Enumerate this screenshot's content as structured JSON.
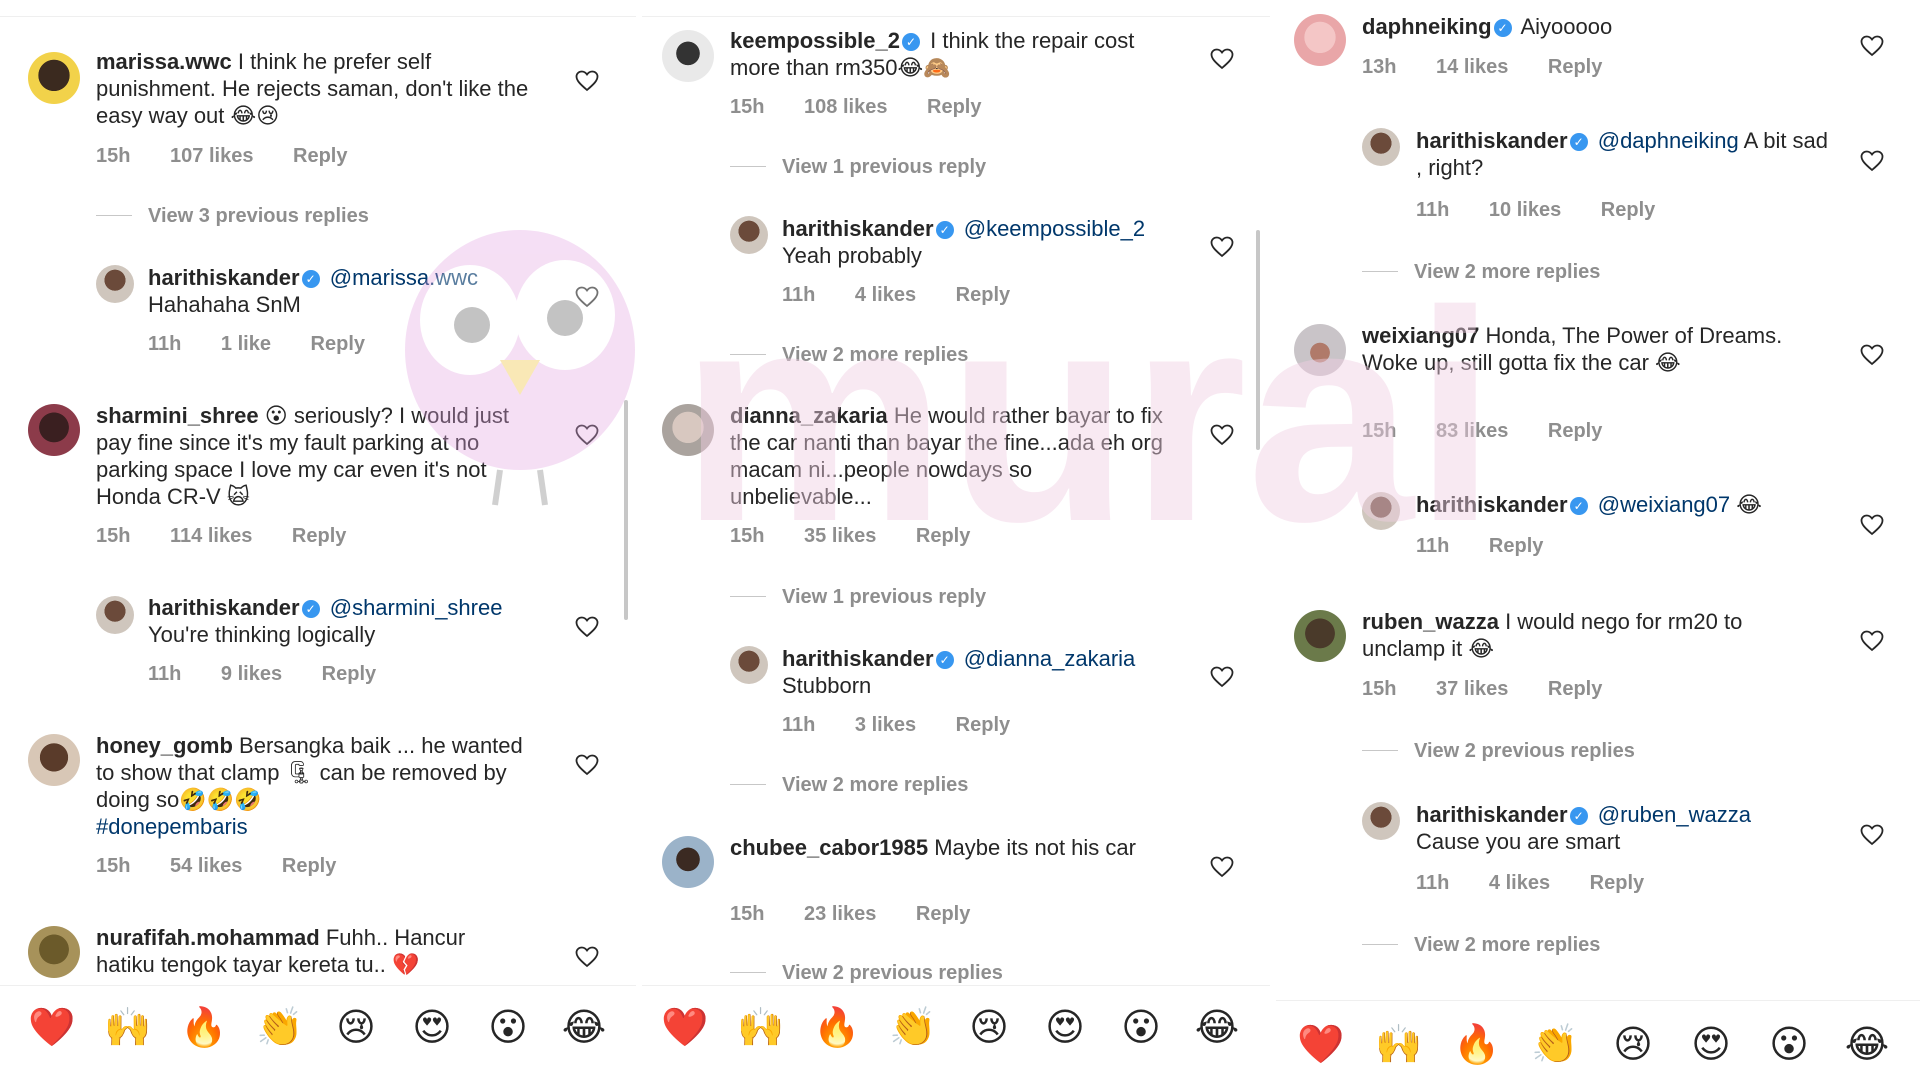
{
  "panels": [
    {
      "comments": [
        {
          "user": "marissa.wwc",
          "text": "I think he prefer self punishment. He rejects saman, don't like the easy way out 😂😢",
          "time": "15h",
          "likes": "107 likes",
          "reply": "Reply"
        },
        {
          "view": "View 3 previous replies"
        },
        {
          "user": "harithiskander",
          "mention": "@marissa.wwc",
          "text": "Hahahaha SnM",
          "time": "11h",
          "likes": "1 like",
          "reply": "Reply"
        },
        {
          "user": "sharmini_shree",
          "text": "😮 seriously? I would just pay fine since it's my fault parking at no parking space  I love my car even it's not Honda CR-V 🙀",
          "time": "15h",
          "likes": "114 likes",
          "reply": "Reply"
        },
        {
          "user": "harithiskander",
          "mention": "@sharmini_shree",
          "text": "You're thinking logically",
          "time": "11h",
          "likes": "9 likes",
          "reply": "Reply"
        },
        {
          "user": "honey_gomb",
          "text": "Bersangka baik ... he wanted to show that clamp 🗜 can be removed by doing so🤣🤣🤣",
          "hashtag": "#donepembaris",
          "time": "15h",
          "likes": "54 likes",
          "reply": "Reply"
        },
        {
          "user": "nurafifah.mohammad",
          "text": "Fuhh.. Hancur hatiku tengok tayar kereta tu.. 💔"
        }
      ]
    },
    {
      "comments": [
        {
          "user": "keempossible_2",
          "text": "I think the repair cost more than rm350😂🙈",
          "time": "15h",
          "likes": "108 likes",
          "reply": "Reply"
        },
        {
          "view": "View 1 previous reply"
        },
        {
          "user": "harithiskander",
          "mention": "@keempossible_2",
          "text": "Yeah probably",
          "time": "11h",
          "likes": "4 likes",
          "reply": "Reply"
        },
        {
          "view": "View 2 more replies"
        },
        {
          "user": "dianna_zakaria",
          "text": "He would rather bayar to fix the car nanti than bayar the fine...ada eh org macam ni...people nowdays so unbelievable...",
          "time": "15h",
          "likes": "35 likes",
          "reply": "Reply"
        },
        {
          "view": "View 1 previous reply"
        },
        {
          "user": "harithiskander",
          "mention": "@dianna_zakaria",
          "text": "Stubborn",
          "time": "11h",
          "likes": "3 likes",
          "reply": "Reply"
        },
        {
          "view": "View 2 more replies"
        },
        {
          "user": "chubee_cabor1985",
          "text": "Maybe its not his car",
          "time": "15h",
          "likes": "23 likes",
          "reply": "Reply"
        },
        {
          "view": "View 2 previous replies"
        }
      ]
    },
    {
      "comments": [
        {
          "user": "daphneiking",
          "text": "Aiyooooo",
          "time": "13h",
          "likes": "14 likes",
          "reply": "Reply"
        },
        {
          "user": "harithiskander",
          "mention": "@daphneiking",
          "text": "A bit sad , right?",
          "time": "11h",
          "likes": "10 likes",
          "reply": "Reply"
        },
        {
          "view": "View 2 more replies"
        },
        {
          "user": "weixiang07",
          "text": "Honda, The Power of Dreams. Woke up, still gotta fix the car 😂",
          "time": "15h",
          "likes": "83 likes",
          "reply": "Reply"
        },
        {
          "user": "harithiskander",
          "mention": "@weixiang07",
          "text": "😂",
          "time": "11h",
          "reply": "Reply"
        },
        {
          "user": "ruben_wazza",
          "text": "I would nego for rm20 to unclamp it 😂",
          "time": "15h",
          "likes": "37 likes",
          "reply": "Reply"
        },
        {
          "view": "View 2 previous replies"
        },
        {
          "user": "harithiskander",
          "mention": "@ruben_wazza",
          "text": "Cause you are smart",
          "time": "11h",
          "likes": "4 likes",
          "reply": "Reply"
        },
        {
          "view": "View 2 more replies"
        }
      ]
    }
  ],
  "reactions": [
    "❤️",
    "🙌",
    "🔥",
    "👏",
    "😢",
    "😍",
    "😮",
    "😂"
  ],
  "watermark": {
    "text": "murai"
  },
  "icons": {
    "like": "heart-outline-icon",
    "verified": "verified-badge-icon"
  },
  "colors": {
    "username": "#262626",
    "meta": "#8e8e8e",
    "mention": "#00376b",
    "verified": "#3897f0"
  }
}
